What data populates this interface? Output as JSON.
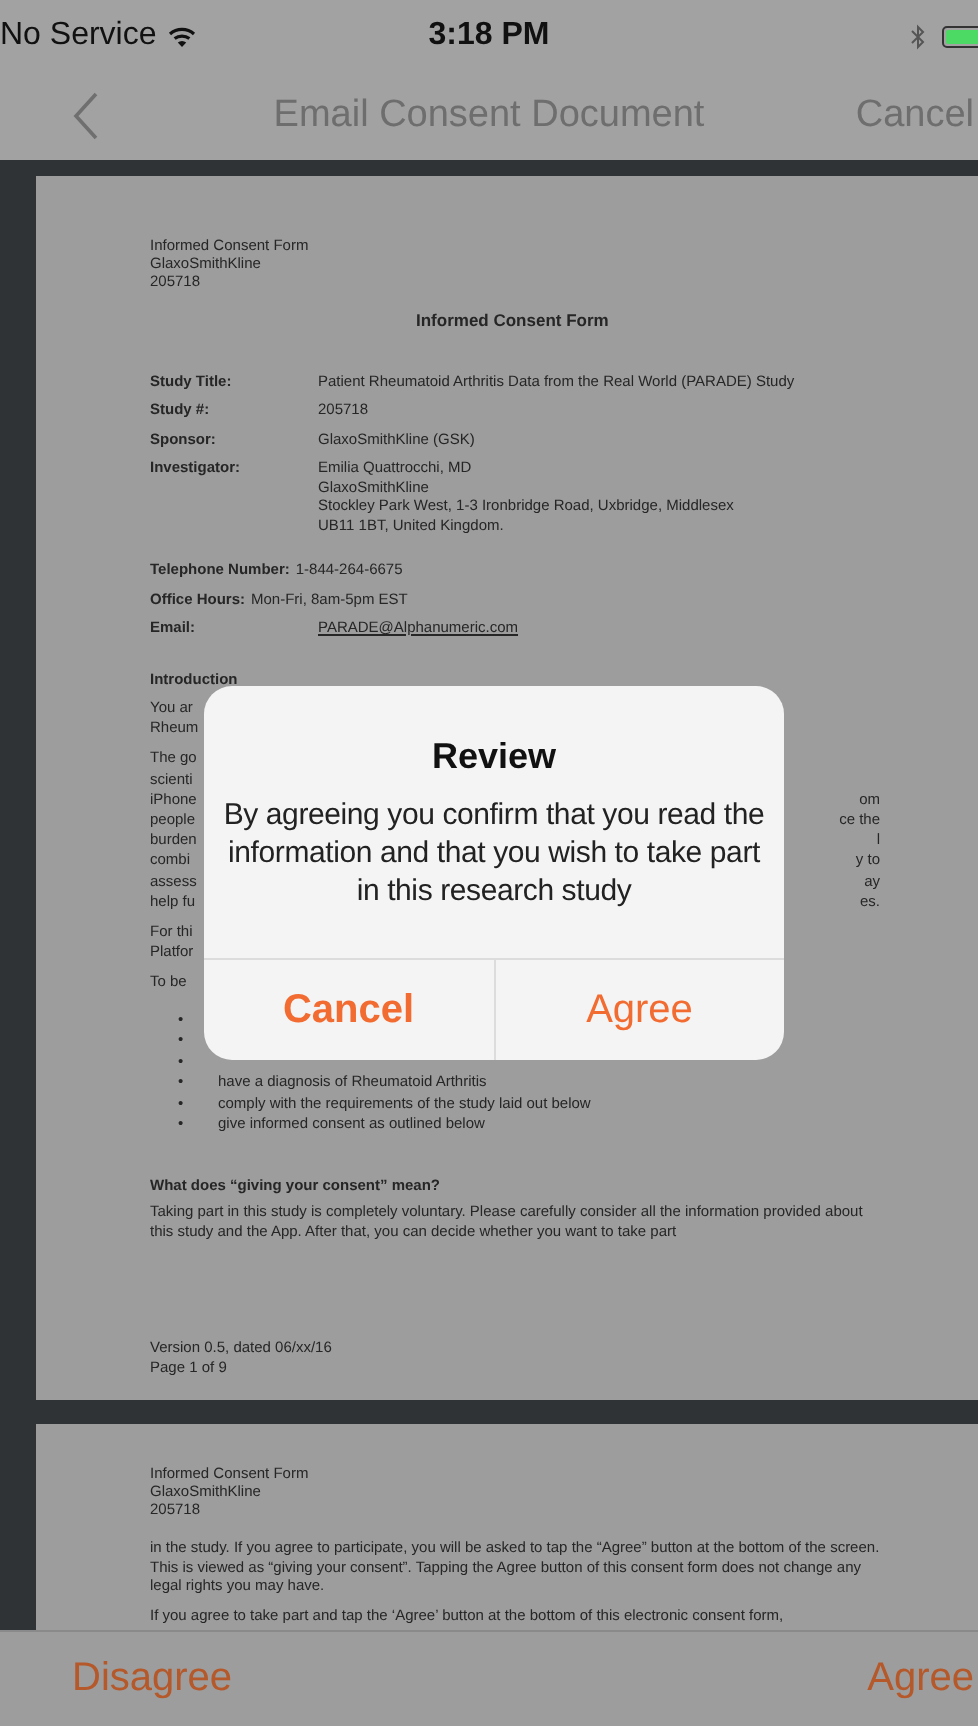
{
  "status_bar": {
    "carrier": "No Service",
    "time": "3:18 PM"
  },
  "nav_bar": {
    "title": "Email Consent Document",
    "right_button": "Cancel"
  },
  "page_1": {
    "header": [
      "Informed Consent Form",
      "GlaxoSmithKline",
      "205718"
    ],
    "title": "Informed Consent Form",
    "fields": [
      {
        "kind": "column",
        "label": "Study Title:",
        "lines": [
          "Patient Rheumatoid Arthritis Data from the Real World (PARADE) Study"
        ]
      },
      {
        "kind": "column",
        "label": "Study #:",
        "lines": [
          "205718"
        ]
      },
      {
        "kind": "column",
        "label": "Sponsor:",
        "lines": [
          "GlaxoSmithKline (GSK)"
        ]
      },
      {
        "kind": "column",
        "label": "Investigator:",
        "lines": [
          "Emilia Quattrocchi, MD",
          "GlaxoSmithKline",
          "Stockley Park West, 1-3 Ironbridge Road, Uxbridge, Middlesex",
          "UB11 1BT, United Kingdom."
        ]
      },
      {
        "kind": "inline",
        "label": "Telephone Number:",
        "lines": [
          "1-844-264-6675"
        ]
      },
      {
        "kind": "inline",
        "label": "Office Hours:",
        "lines": [
          "Mon-Fri, 8am-5pm EST"
        ]
      },
      {
        "kind": "link",
        "label": "Email:",
        "lines": [
          "PARADE@Alphanumeric.com"
        ]
      }
    ],
    "intro_heading": "Introduction",
    "fragment_groups": [
      [
        {
          "left": "You ar"
        },
        {
          "left": "Rheum"
        }
      ],
      [
        {
          "left": "The go"
        },
        {
          "left": "scienti"
        },
        {
          "left": "iPhone",
          "right": "om"
        },
        {
          "left": "people",
          "right": "ce the"
        },
        {
          "left": "burden",
          "right": "l"
        },
        {
          "left": "combi",
          "right": "y to"
        },
        {
          "left": "assess",
          "right": "ay"
        },
        {
          "left": "help fu",
          "right": "es."
        }
      ],
      [
        {
          "left": "For thi"
        },
        {
          "left": "Platfor"
        }
      ],
      [
        {
          "left": "To be"
        }
      ]
    ],
    "bullets": [
      {
        "marker": "•"
      },
      {
        "marker": "•"
      },
      {
        "marker": "•"
      },
      {
        "marker": "•",
        "text": "have a diagnosis of Rheumatoid Arthritis"
      },
      {
        "marker": "•",
        "text": "comply with the requirements of the study laid out below"
      },
      {
        "marker": "•",
        "text": "give informed consent as outlined below"
      }
    ],
    "section_heading": "What does “giving your consent” mean?",
    "section_text": "Taking part in this study is completely voluntary. Please carefully consider all the information provided about this study and the App. After that, you can decide whether you want to take part",
    "footer": [
      "Version 0.5, dated 06/xx/16",
      "Page 1 of 9"
    ]
  },
  "page_2": {
    "header": [
      "Informed Consent Form",
      "GlaxoSmithKline",
      "205718"
    ],
    "paragraphs": [
      "in the study. If you agree to participate, you will be asked to tap the “Agree” button at the bottom of the screen.  This is viewed as “giving your consent”. Tapping the Agree button of this consent form does not change any legal rights you may have.",
      "If you agree to take part and tap the ‘Agree’ button at the bottom of this electronic consent form,"
    ]
  },
  "dialog": {
    "title": "Review",
    "message": "By agreeing you confirm that you read the information and that you wish to take part in this research study",
    "buttons": [
      {
        "label": "Cancel",
        "bold": true
      },
      {
        "label": "Agree",
        "bold": false
      }
    ]
  },
  "toolbar": {
    "left": "Disagree",
    "right": "Agree"
  }
}
